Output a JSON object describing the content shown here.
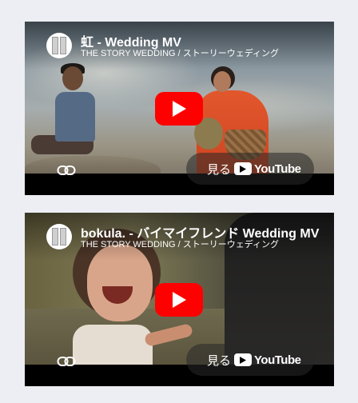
{
  "videos": [
    {
      "title": "虹 - Wedding MV",
      "channel": "THE STORY WEDDING / ストーリーウェディング",
      "watch_label": "見る",
      "platform": "YouTube"
    },
    {
      "title": "bokula. - バイマイフレンド Wedding MV",
      "channel": "THE STORY WEDDING / ストーリーウェディング",
      "watch_label": "見る",
      "platform": "YouTube"
    }
  ],
  "icons": {
    "play": "play-icon",
    "copy_link": "link-icon",
    "youtube": "youtube-logo-icon"
  },
  "colors": {
    "page_background": "#eceef3",
    "play_button": "#ff0000",
    "overlay_text": "#ffffff"
  }
}
